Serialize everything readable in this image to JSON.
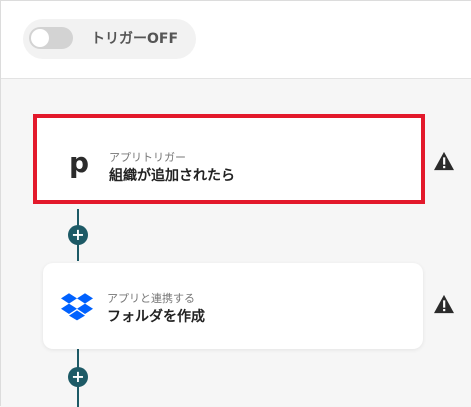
{
  "toggle": {
    "label": "トリガーOFF",
    "state": "off"
  },
  "steps": [
    {
      "subtitle": "アプリトリガー",
      "title": "組織が追加されたら",
      "icon": "pipedrive-p-icon",
      "selected": true,
      "warning": true
    },
    {
      "subtitle": "アプリと連携する",
      "title": "フォルダを作成",
      "icon": "dropbox-icon",
      "selected": false,
      "warning": true
    }
  ],
  "colors": {
    "connector": "#1d5a66",
    "selected_border": "#e3192b",
    "dropbox": "#0061fe"
  }
}
